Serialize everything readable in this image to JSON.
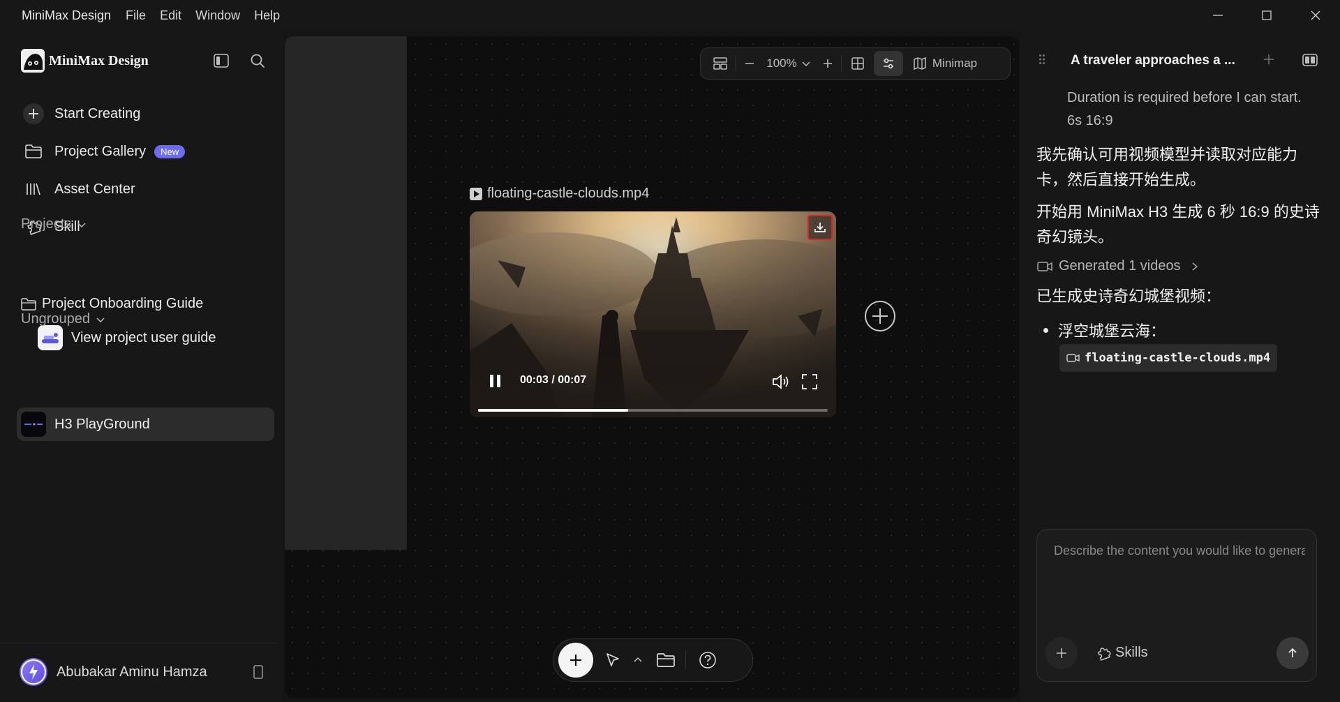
{
  "titlebar": {
    "app_name": "MiniMax Design",
    "menus": [
      "File",
      "Edit",
      "Window",
      "Help"
    ]
  },
  "sidebar": {
    "brand": "MiniMax Design",
    "nav": [
      {
        "label": "Start Creating",
        "icon": "plus-icon"
      },
      {
        "label": "Project Gallery",
        "icon": "folder-icon",
        "badge": "New"
      },
      {
        "label": "Asset Center",
        "icon": "library-icon"
      },
      {
        "label": "Skill",
        "icon": "puzzle-icon"
      }
    ],
    "projects_header": "Projects",
    "project_folder": "Project Onboarding Guide",
    "guide_item": "View project user guide",
    "ungrouped_header": "Ungrouped",
    "active_item": "H3 PlayGround",
    "user_name": "Abubakar Aminu Hamza"
  },
  "canvas": {
    "toolbar": {
      "zoom": "100%",
      "minimap_label": "Minimap"
    },
    "video": {
      "filename": "floating-castle-clouds.mp4",
      "time": "00:03 / 00:07",
      "progress": 0.43
    }
  },
  "chat": {
    "title": "A traveler approaches a ...",
    "messages": {
      "muted_1": "Duration is required before I can start.",
      "muted_2": "6s 16:9",
      "ai_1": "我先确认可用视频模型并读取对应能力卡，然后直接开始生成。",
      "ai_2": "开始用 MiniMax H3 生成 6 秒 16:9 的史诗奇幻镜头。",
      "generated": "Generated 1 videos",
      "ai_3": "已生成史诗奇幻城堡视频：",
      "bullet": "浮空城堡云海：",
      "file_chip": "floating-castle-clouds.mp4"
    },
    "composer": {
      "placeholder": "Describe the content you would like to generate",
      "skills_label": "Skills"
    }
  },
  "colors": {
    "accent": "#6d6cf0",
    "highlight_border": "#e0202a"
  }
}
